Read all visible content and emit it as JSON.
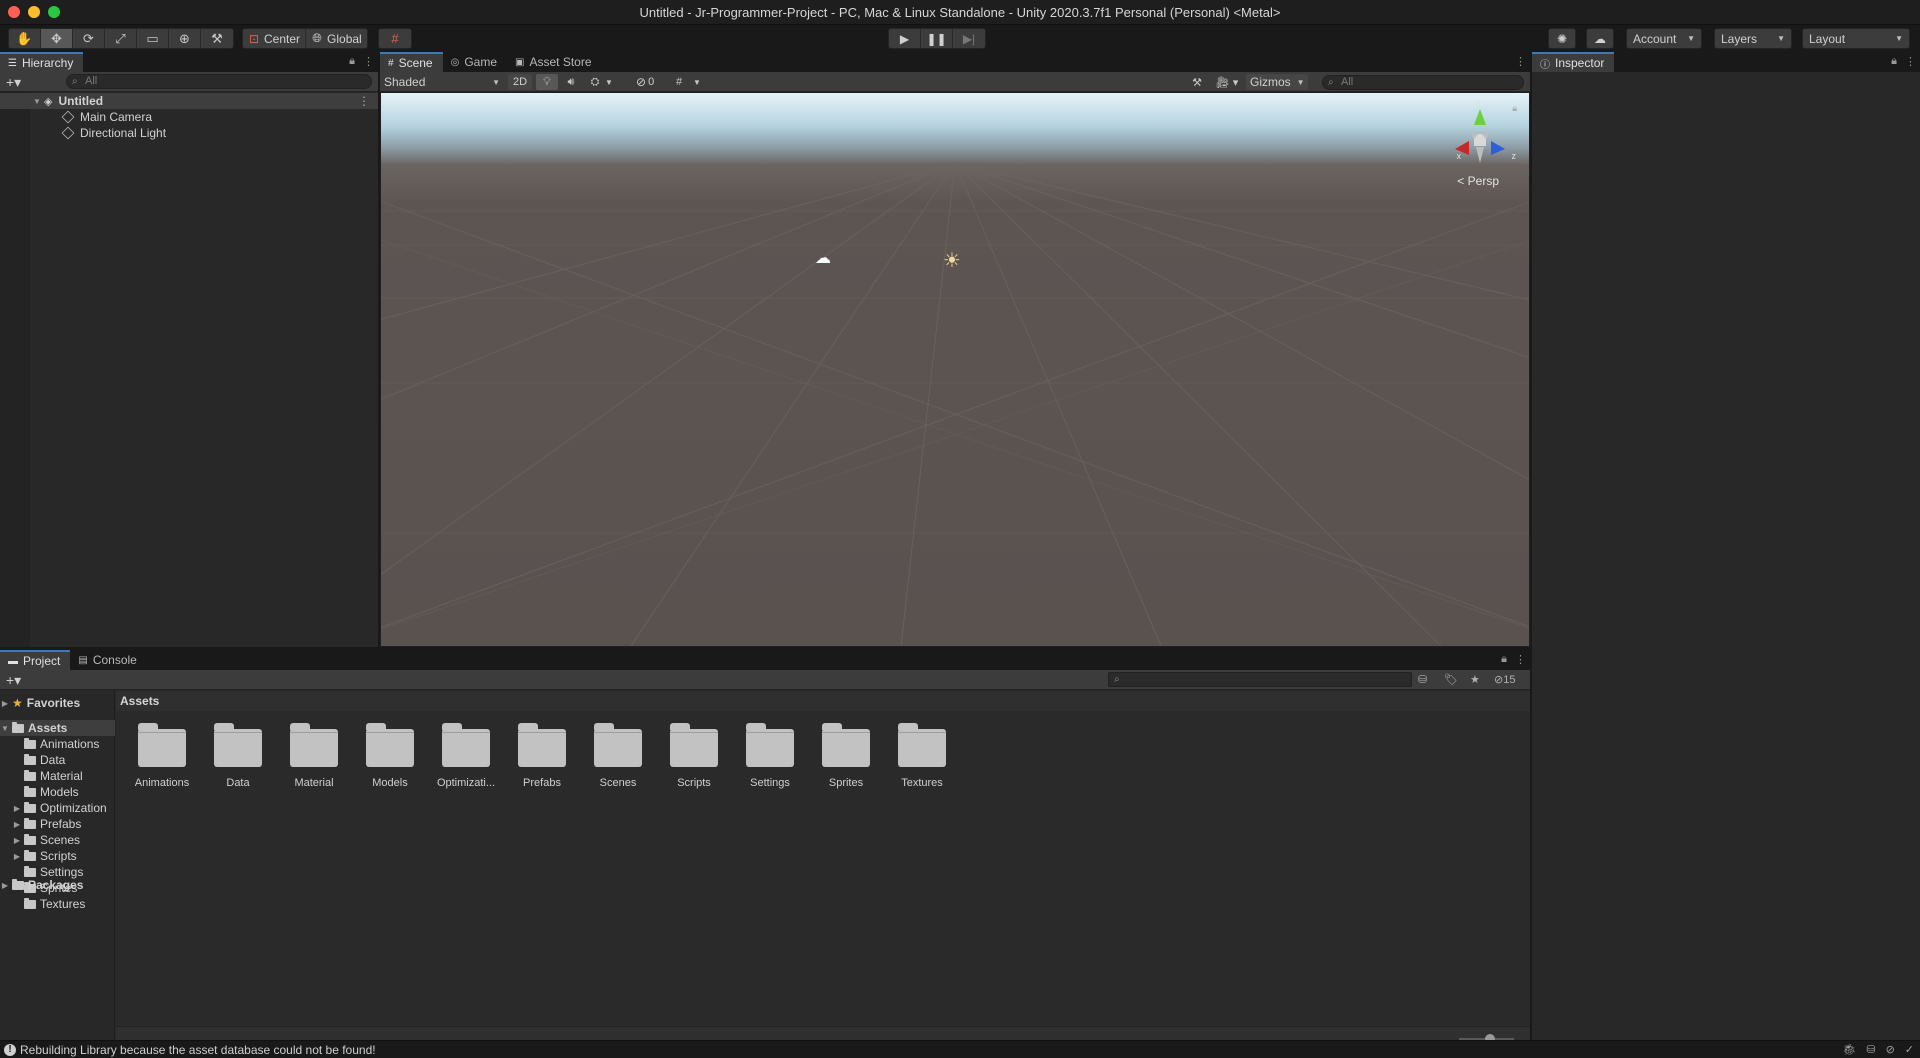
{
  "window": {
    "title": "Untitled - Jr-Programmer-Project - PC, Mac & Linux Standalone - Unity 2020.3.7f1 Personal (Personal) <Metal>"
  },
  "toolbar": {
    "tools": [
      "hand-icon",
      "move-icon",
      "rotate-icon",
      "scale-icon",
      "rect-icon",
      "transform-icon",
      "custom-tool-icon"
    ],
    "pivot_label": "Center",
    "space_label": "Global",
    "account_label": "Account",
    "layers_label": "Layers",
    "layout_label": "Layout"
  },
  "hierarchy": {
    "tab_label": "Hierarchy",
    "search_placeholder": "All",
    "scene_name": "Untitled",
    "items": [
      {
        "label": "Main Camera"
      },
      {
        "label": "Directional Light"
      }
    ]
  },
  "scene": {
    "tabs": [
      {
        "label": "Scene"
      },
      {
        "label": "Game"
      },
      {
        "label": "Asset Store"
      }
    ],
    "shading_mode": "Shaded",
    "mode_2d_label": "2D",
    "hidden_count": "0",
    "gizmos_label": "Gizmos",
    "search_placeholder": "All",
    "persp_label": "Persp",
    "axis_labels": {
      "x": "x",
      "y": "y",
      "z": "z"
    }
  },
  "inspector": {
    "tab_label": "Inspector"
  },
  "project": {
    "tabs": [
      {
        "label": "Project"
      },
      {
        "label": "Console"
      }
    ],
    "hidden_packages_count": "15",
    "breadcrumb": "Assets",
    "tree": {
      "favorites": "Favorites",
      "assets": "Assets",
      "children": [
        {
          "label": "Animations",
          "expandable": false
        },
        {
          "label": "Data",
          "expandable": false
        },
        {
          "label": "Material",
          "expandable": false
        },
        {
          "label": "Models",
          "expandable": false
        },
        {
          "label": "Optimization",
          "expandable": true
        },
        {
          "label": "Prefabs",
          "expandable": true
        },
        {
          "label": "Scenes",
          "expandable": true
        },
        {
          "label": "Scripts",
          "expandable": true
        },
        {
          "label": "Settings",
          "expandable": false
        },
        {
          "label": "Sprites",
          "expandable": false
        },
        {
          "label": "Textures",
          "expandable": false
        }
      ],
      "packages": "Packages"
    },
    "folders": [
      {
        "label": "Animations"
      },
      {
        "label": "Data"
      },
      {
        "label": "Material"
      },
      {
        "label": "Models"
      },
      {
        "label": "Optimizati..."
      },
      {
        "label": "Prefabs"
      },
      {
        "label": "Scenes"
      },
      {
        "label": "Scripts"
      },
      {
        "label": "Settings"
      },
      {
        "label": "Sprites"
      },
      {
        "label": "Textures"
      }
    ]
  },
  "status": {
    "message": "Rebuilding Library because the asset database could not be found!"
  },
  "colors": {
    "accent": "#3a79bb",
    "panel_bg": "#282828",
    "toolbar_bg": "#3c3c3c"
  }
}
